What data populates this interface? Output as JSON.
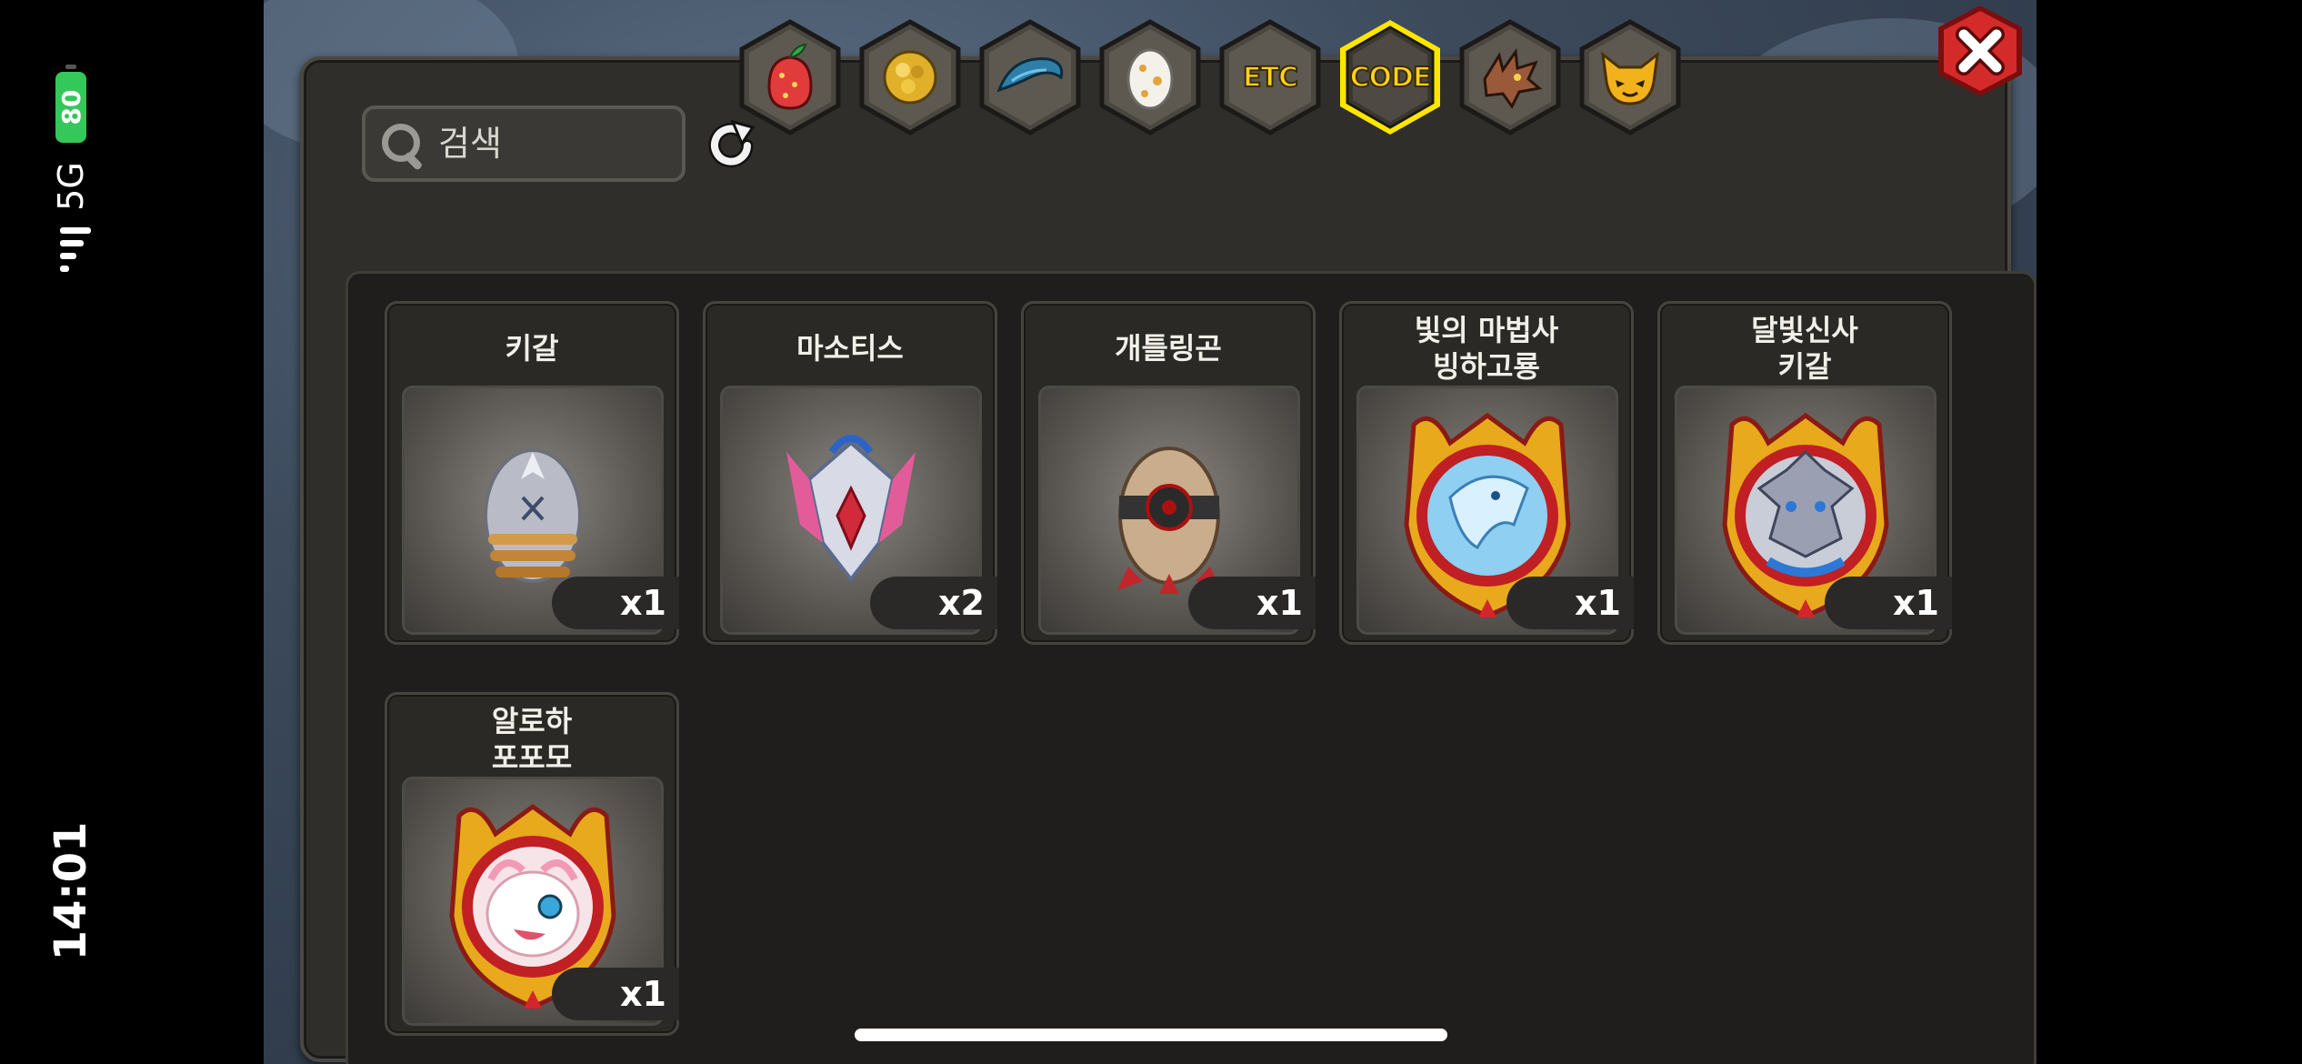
{
  "status_bar": {
    "time": "14:01",
    "network": "5G",
    "battery": "80"
  },
  "search": {
    "placeholder": "검색"
  },
  "tabs": [
    {
      "name": "fruit",
      "icon": "fruit-icon",
      "text": ""
    },
    {
      "name": "gold",
      "icon": "gold-icon",
      "text": ""
    },
    {
      "name": "scale",
      "icon": "scale-icon",
      "text": ""
    },
    {
      "name": "egg",
      "icon": "egg-icon",
      "text": ""
    },
    {
      "name": "etc",
      "icon": "",
      "text": "ETC"
    },
    {
      "name": "code",
      "icon": "",
      "text": "CODE",
      "selected": true
    },
    {
      "name": "dragon",
      "icon": "dragon-icon",
      "text": ""
    },
    {
      "name": "pet",
      "icon": "pet-icon",
      "text": ""
    }
  ],
  "items": [
    {
      "name": "키갈",
      "qty": "x1",
      "kind": "egg-grey"
    },
    {
      "name": "마소티스",
      "qty": "x2",
      "kind": "crest"
    },
    {
      "name": "개틀링곤",
      "qty": "x1",
      "kind": "egg-gatling"
    },
    {
      "name": "빛의 마법사\n빙하고룡",
      "qty": "x1",
      "kind": "medal-blue"
    },
    {
      "name": "달빛신사\n키갈",
      "qty": "x1",
      "kind": "medal-grey"
    },
    {
      "name": "알로하\n포포모",
      "qty": "x1",
      "kind": "medal-pink"
    }
  ],
  "colors": {
    "accent_yellow": "#ffd21f",
    "close_red": "#d42a2a",
    "panel": "#2f2e2b"
  }
}
